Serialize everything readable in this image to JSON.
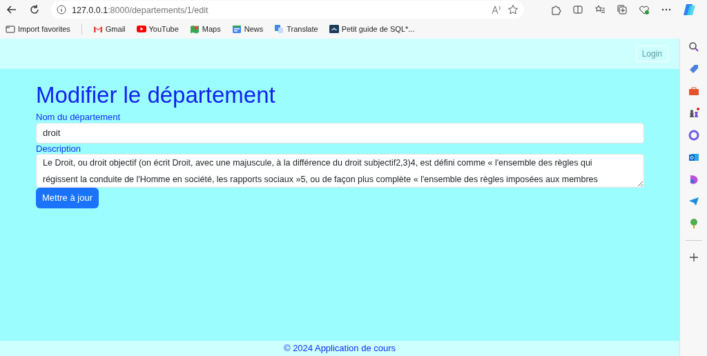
{
  "browser": {
    "url_host": "127.0.0.1",
    "url_rest": ":8000/departements/1/edit",
    "bookmarks": [
      {
        "kind": "import",
        "label": "Import favorites"
      },
      {
        "kind": "gmail",
        "label": "Gmail"
      },
      {
        "kind": "youtube",
        "label": "YouTube"
      },
      {
        "kind": "maps",
        "label": "Maps"
      },
      {
        "kind": "news",
        "label": "News"
      },
      {
        "kind": "translate",
        "label": "Translate"
      },
      {
        "kind": "sql",
        "label": "Petit guide de SQL*..."
      }
    ]
  },
  "navbar": {
    "login": "Login"
  },
  "page": {
    "title": "Modifier le département",
    "fields": [
      {
        "kind": "input",
        "label": "Nom du département",
        "value": "droit"
      },
      {
        "kind": "textarea",
        "label": "Description",
        "value": "Le Droit, ou droit objectif (on écrit Droit, avec une majuscule, à la différence du droit subjectif2,3)4, est défini comme « l'ensemble des règles qui régissent la conduite de l'Homme en société, les rapports sociaux »5, ou de façon plus complète « l'ensemble des règles imposées aux membres"
      }
    ],
    "submit": "Mettre à jour"
  },
  "footer": "© 2024 Application de cours"
}
